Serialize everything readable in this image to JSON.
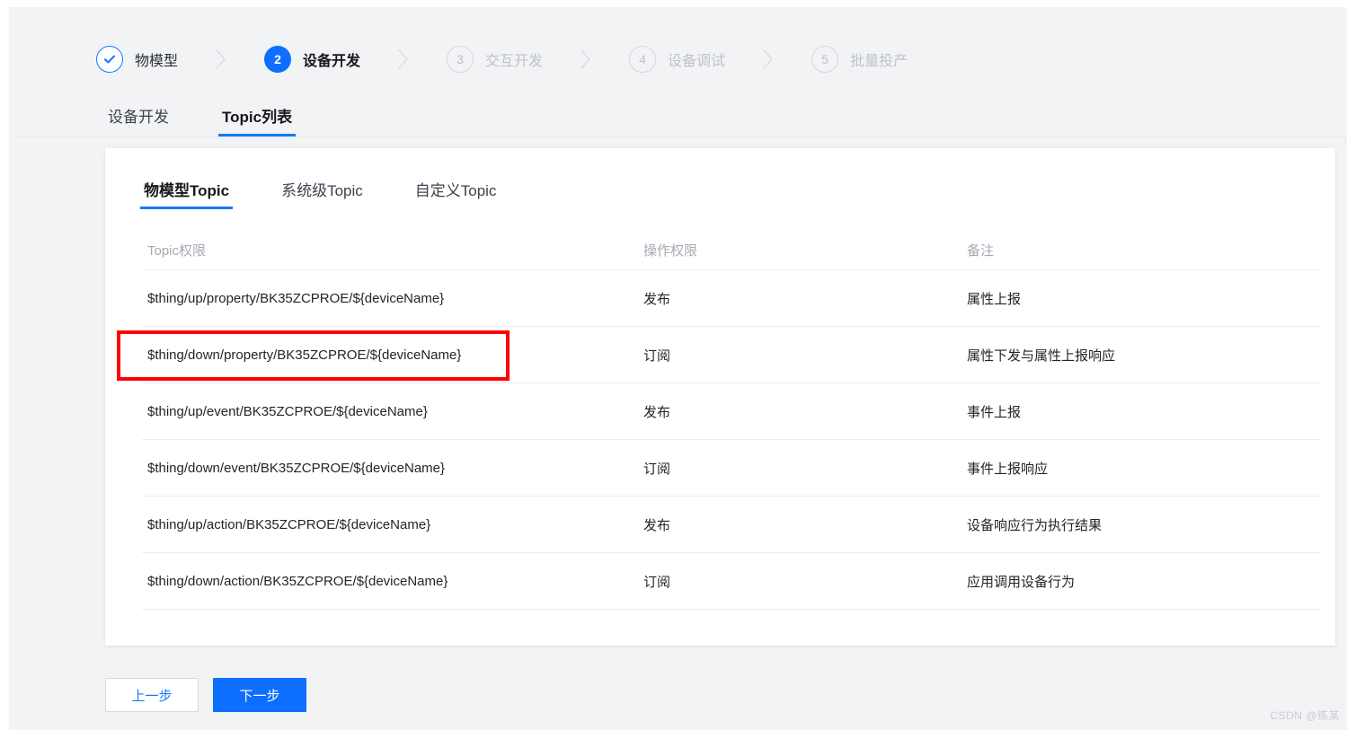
{
  "stepper": {
    "steps": [
      {
        "badge": "check-icon",
        "number": "",
        "label": "物模型",
        "state": "done"
      },
      {
        "badge": "number",
        "number": "2",
        "label": "设备开发",
        "state": "current"
      },
      {
        "badge": "number",
        "number": "3",
        "label": "交互开发",
        "state": "todo"
      },
      {
        "badge": "number",
        "number": "4",
        "label": "设备调试",
        "state": "todo"
      },
      {
        "badge": "number",
        "number": "5",
        "label": "批量投产",
        "state": "todo"
      }
    ],
    "separator_icon": "chevron-right-icon"
  },
  "outer_tabs": [
    {
      "label": "设备开发",
      "active": false
    },
    {
      "label": "Topic列表",
      "active": true
    }
  ],
  "inner_tabs": [
    {
      "label": "物模型Topic",
      "active": true
    },
    {
      "label": "系统级Topic",
      "active": false
    },
    {
      "label": "自定义Topic",
      "active": false
    }
  ],
  "table": {
    "headers": [
      "Topic权限",
      "操作权限",
      "备注"
    ],
    "rows": [
      {
        "topic": "$thing/up/property/BK35ZCPROE/${deviceName}",
        "permission": "发布",
        "remark": "属性上报",
        "highlighted": false
      },
      {
        "topic": "$thing/down/property/BK35ZCPROE/${deviceName}",
        "permission": "订阅",
        "remark": "属性下发与属性上报响应",
        "highlighted": true
      },
      {
        "topic": "$thing/up/event/BK35ZCPROE/${deviceName}",
        "permission": "发布",
        "remark": "事件上报",
        "highlighted": false
      },
      {
        "topic": "$thing/down/event/BK35ZCPROE/${deviceName}",
        "permission": "订阅",
        "remark": "事件上报响应",
        "highlighted": false
      },
      {
        "topic": "$thing/up/action/BK35ZCPROE/${deviceName}",
        "permission": "发布",
        "remark": "设备响应行为执行结果",
        "highlighted": false
      },
      {
        "topic": "$thing/down/action/BK35ZCPROE/${deviceName}",
        "permission": "订阅",
        "remark": "应用调用设备行为",
        "highlighted": false
      }
    ]
  },
  "footer": {
    "prev_label": "上一步",
    "next_label": "下一步"
  },
  "watermark": "CSDN @练某",
  "colors": {
    "accent": "#1677ff",
    "accent_fill": "#0e6eff",
    "highlight": "#ff0000",
    "page_bg": "#f2f3f5",
    "card_bg": "#ffffff",
    "muted": "#bfc2c9",
    "divider": "#ebedf0"
  }
}
